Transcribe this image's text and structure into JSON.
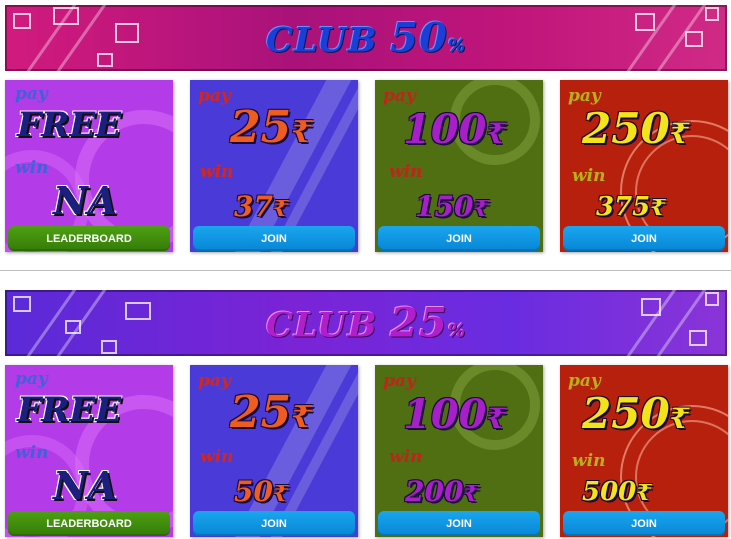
{
  "sections": [
    {
      "banner": {
        "prefix": "CLUB ",
        "value": "50",
        "sign": "%",
        "bg": "#c2157a",
        "text_color": "#1b3fd6"
      },
      "cards": [
        {
          "type": "free",
          "pay_label": "pay",
          "pay_value": "FREE",
          "win_label": "win",
          "win_value": "NA",
          "button": "LEADERBOARD"
        },
        {
          "type": "25",
          "pay_label": "pay",
          "pay_value": "25",
          "currency": "₹",
          "win_label": "win",
          "win_value": "37",
          "button": "JOIN"
        },
        {
          "type": "100",
          "pay_label": "pay",
          "pay_value": "100",
          "currency": "₹",
          "win_label": "win",
          "win_value": "150",
          "button": "JOIN"
        },
        {
          "type": "250",
          "pay_label": "pay",
          "pay_value": "250",
          "currency": "₹",
          "win_label": "win",
          "win_value": "375",
          "button": "JOIN"
        }
      ]
    },
    {
      "banner": {
        "prefix": "CLUB ",
        "value": "25",
        "sign": "%",
        "bg": "#6a24e0",
        "text_color": "#b21ecb"
      },
      "cards": [
        {
          "type": "free",
          "pay_label": "pay",
          "pay_value": "FREE",
          "win_label": "win",
          "win_value": "NA",
          "button": "LEADERBOARD"
        },
        {
          "type": "25",
          "pay_label": "pay",
          "pay_value": "25",
          "currency": "₹",
          "win_label": "win",
          "win_value": "50",
          "button": "JOIN"
        },
        {
          "type": "100",
          "pay_label": "pay",
          "pay_value": "100",
          "currency": "₹",
          "win_label": "win",
          "win_value": "200",
          "button": "JOIN"
        },
        {
          "type": "250",
          "pay_label": "pay",
          "pay_value": "250",
          "currency": "₹",
          "win_label": "win",
          "win_value": "500",
          "button": "JOIN"
        }
      ]
    }
  ]
}
